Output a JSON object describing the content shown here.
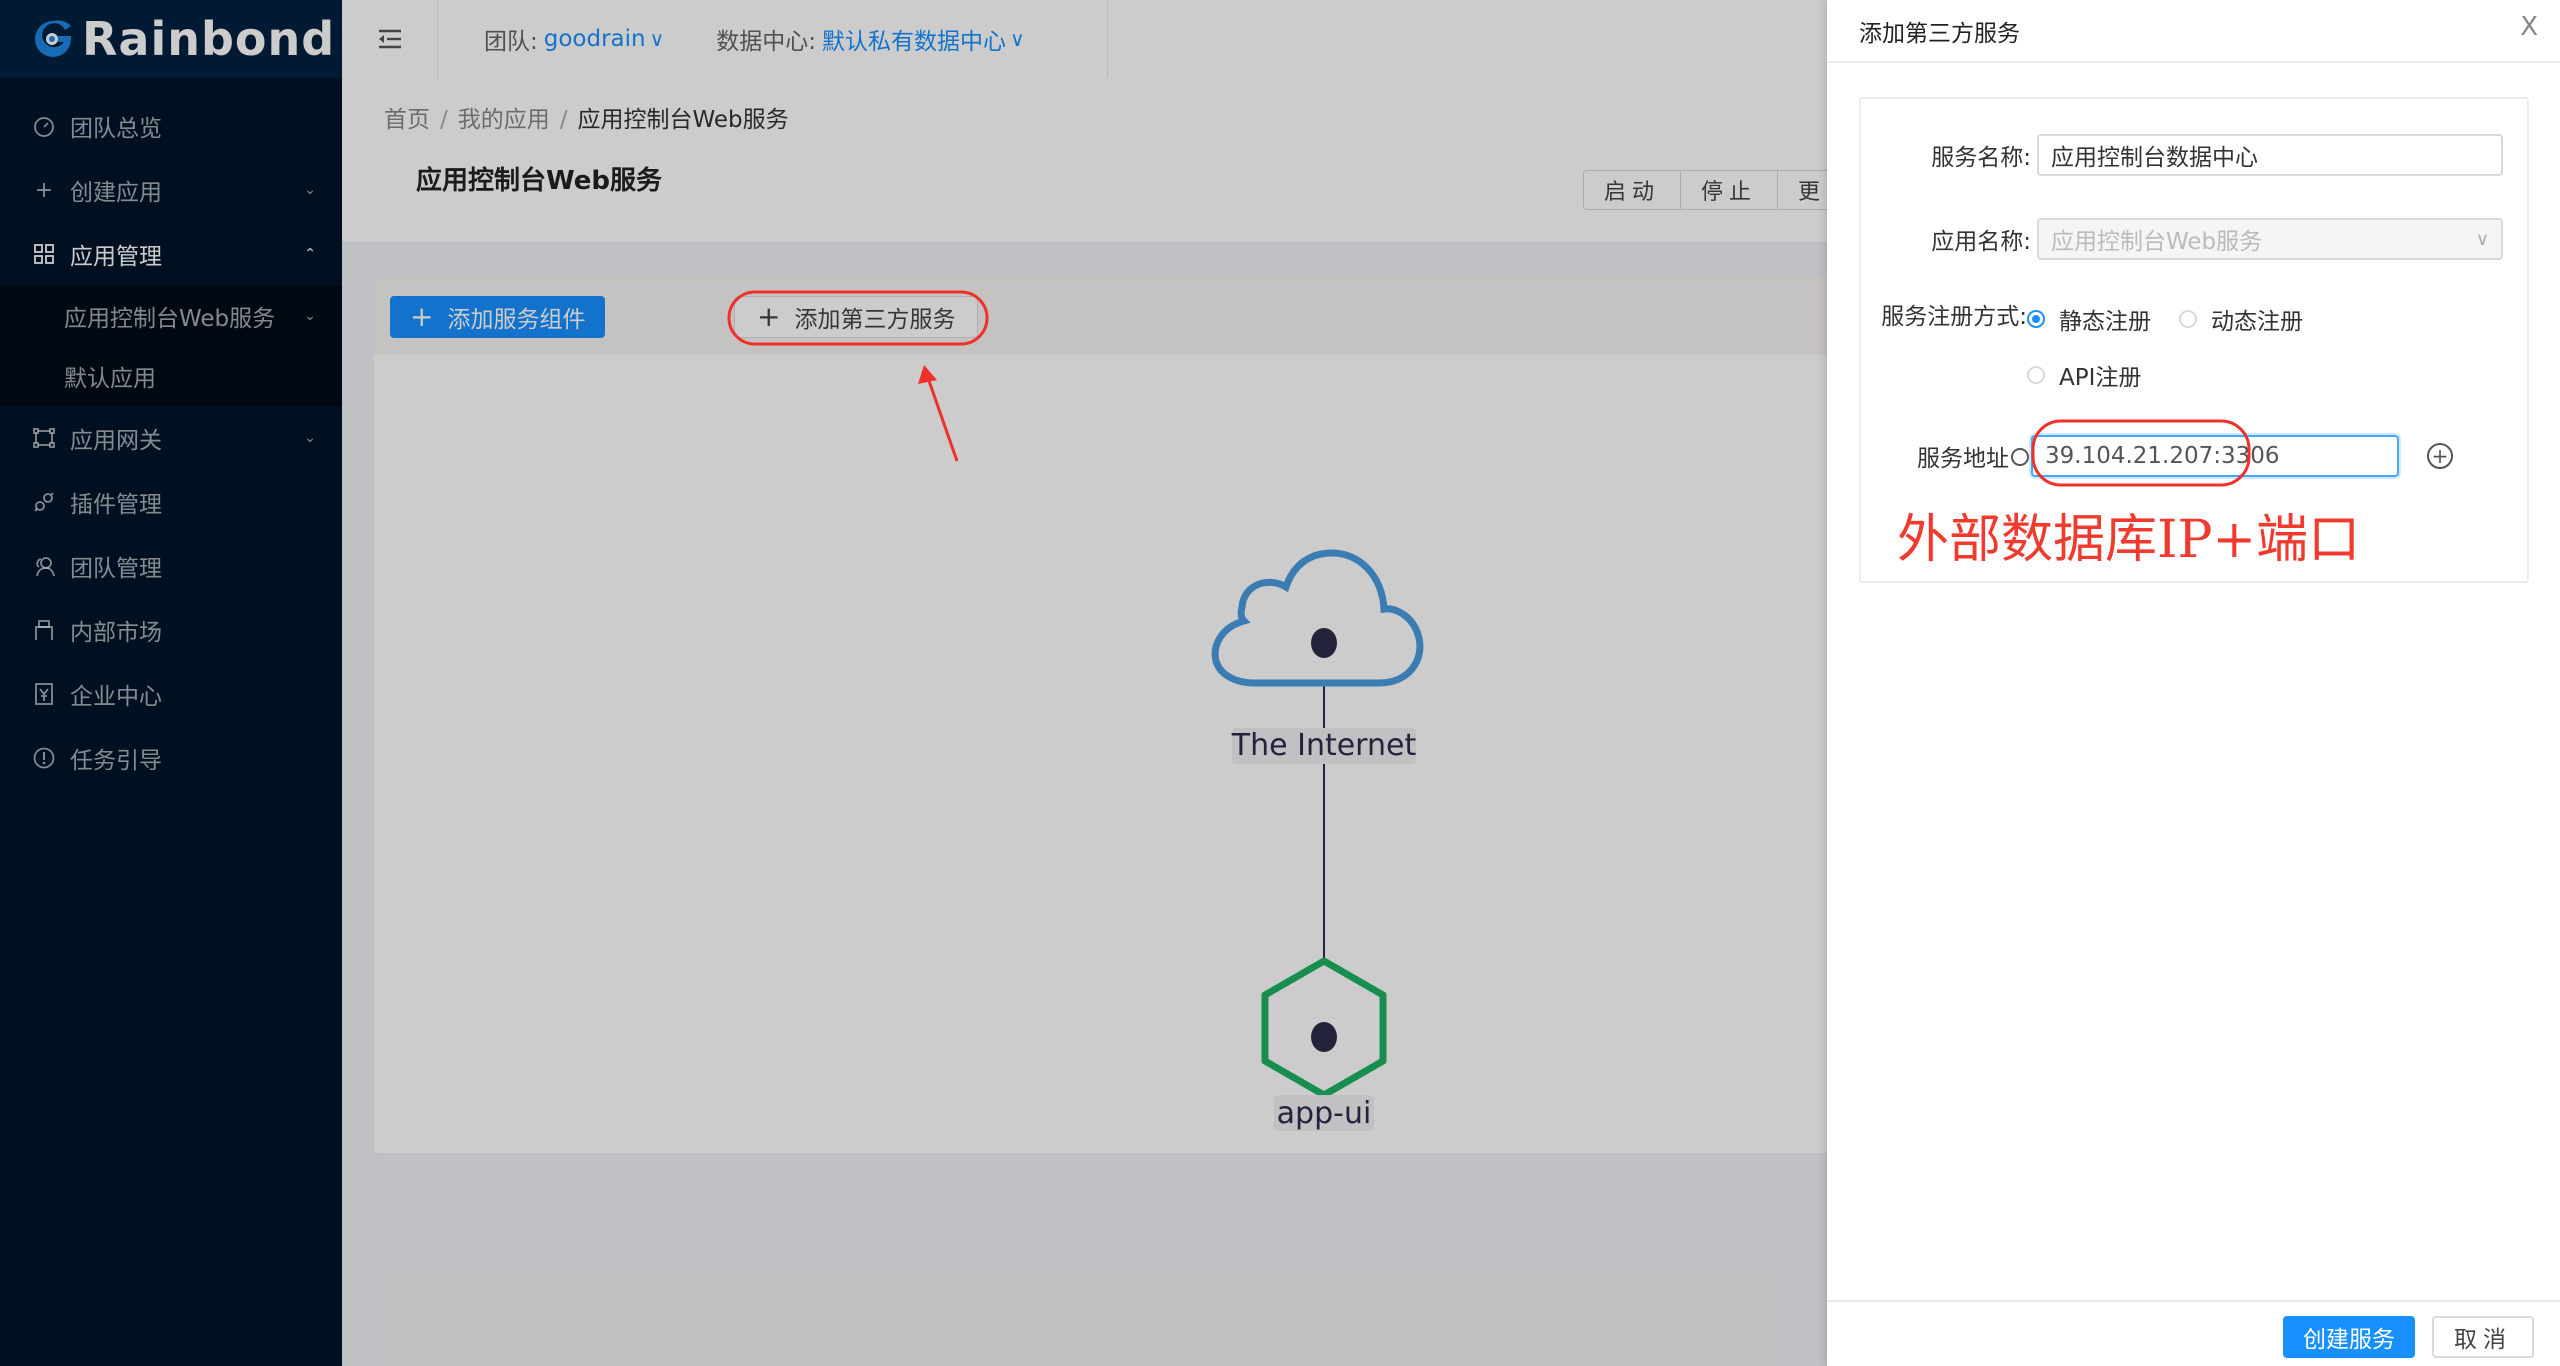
{
  "brand": {
    "name": "Rainbond",
    "accent": "#1890ff"
  },
  "sidebar": {
    "items": [
      {
        "label": "团队总览",
        "icon": "dashboard-icon"
      },
      {
        "label": "创建应用",
        "icon": "plus-icon",
        "caret": "down"
      },
      {
        "label": "应用管理",
        "icon": "grid-icon",
        "caret": "up",
        "open": true,
        "children": [
          {
            "label": "应用控制台Web服务",
            "caret": "down"
          },
          {
            "label": "默认应用"
          }
        ]
      },
      {
        "label": "应用网关",
        "icon": "gateway-icon",
        "caret": "down"
      },
      {
        "label": "插件管理",
        "icon": "plug-icon"
      },
      {
        "label": "团队管理",
        "icon": "team-icon"
      },
      {
        "label": "内部市场",
        "icon": "market-icon"
      },
      {
        "label": "企业中心",
        "icon": "enterprise-icon"
      },
      {
        "label": "任务引导",
        "icon": "info-icon"
      }
    ]
  },
  "header": {
    "team_label": "团队:",
    "team_value": "goodrain",
    "datacenter_label": "数据中心:",
    "datacenter_value": "默认私有数据中心"
  },
  "page": {
    "breadcrumb": [
      "首页",
      "我的应用",
      "应用控制台Web服务"
    ],
    "breadcrumb_sep": "/",
    "title": "应用控制台Web服务",
    "actions": [
      "启动",
      "停止",
      "更"
    ]
  },
  "card": {
    "add_component": "添加服务组件",
    "add_third_party": "添加第三方服务"
  },
  "topology": {
    "nodes": [
      {
        "label": "The Internet",
        "shape": "cloud",
        "color": "#4a9de0"
      },
      {
        "label": "app-ui",
        "shape": "hexagon",
        "color": "#1db262"
      }
    ],
    "edges": [
      [
        "The Internet",
        "app-ui"
      ]
    ]
  },
  "drawer": {
    "title": "添加第三方服务",
    "close": "X",
    "fields": {
      "service_name_label": "服务名称:",
      "service_name_value": "应用控制台数据中心",
      "app_name_label": "应用名称:",
      "app_name_value": "应用控制台Web服务",
      "register_label": "服务注册方式:",
      "register_options": [
        "静态注册",
        "动态注册",
        "API注册"
      ],
      "register_selected": "静态注册",
      "address_label": "服务地址",
      "address_value": "39.104.21.207:3306"
    },
    "annotation": "外部数据库IP+端口",
    "create_button": "创建服务",
    "cancel_button": "取消"
  }
}
